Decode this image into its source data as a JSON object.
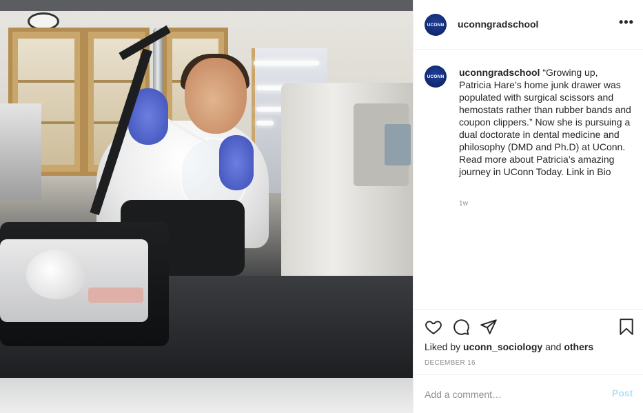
{
  "post": {
    "author": "uconngradschool",
    "avatar_text": "UCONN",
    "more_icon": "•••",
    "caption_user": "uconngradschool",
    "caption_text": "“Growing up, Patricia Hare’s home junk drawer was populated with surgical scissors and hemostats rather than rubber bands and coupon clippers.” Now she is pursuing a dual doctorate in dental medicine and philosophy (DMD and Ph.D) at UConn. Read more about Patricia’s amazing journey in UConn Today. Link in Bio",
    "time_ago": "1w",
    "likes": {
      "prefix": "Liked by",
      "user": "uconn_sociology",
      "joiner": "and",
      "others": "others"
    },
    "date": "DECEMBER 16"
  },
  "actions": {
    "icons": [
      "heart-icon",
      "comment-icon",
      "share-icon",
      "bookmark-icon"
    ]
  },
  "comment": {
    "placeholder": "Add a comment…",
    "post_label": "Post",
    "post_color": "#b2dffc"
  },
  "colors": {
    "text": "#262626",
    "muted": "#8e8e8e",
    "border": "#efefef",
    "avatar": "#0c1f5e"
  }
}
